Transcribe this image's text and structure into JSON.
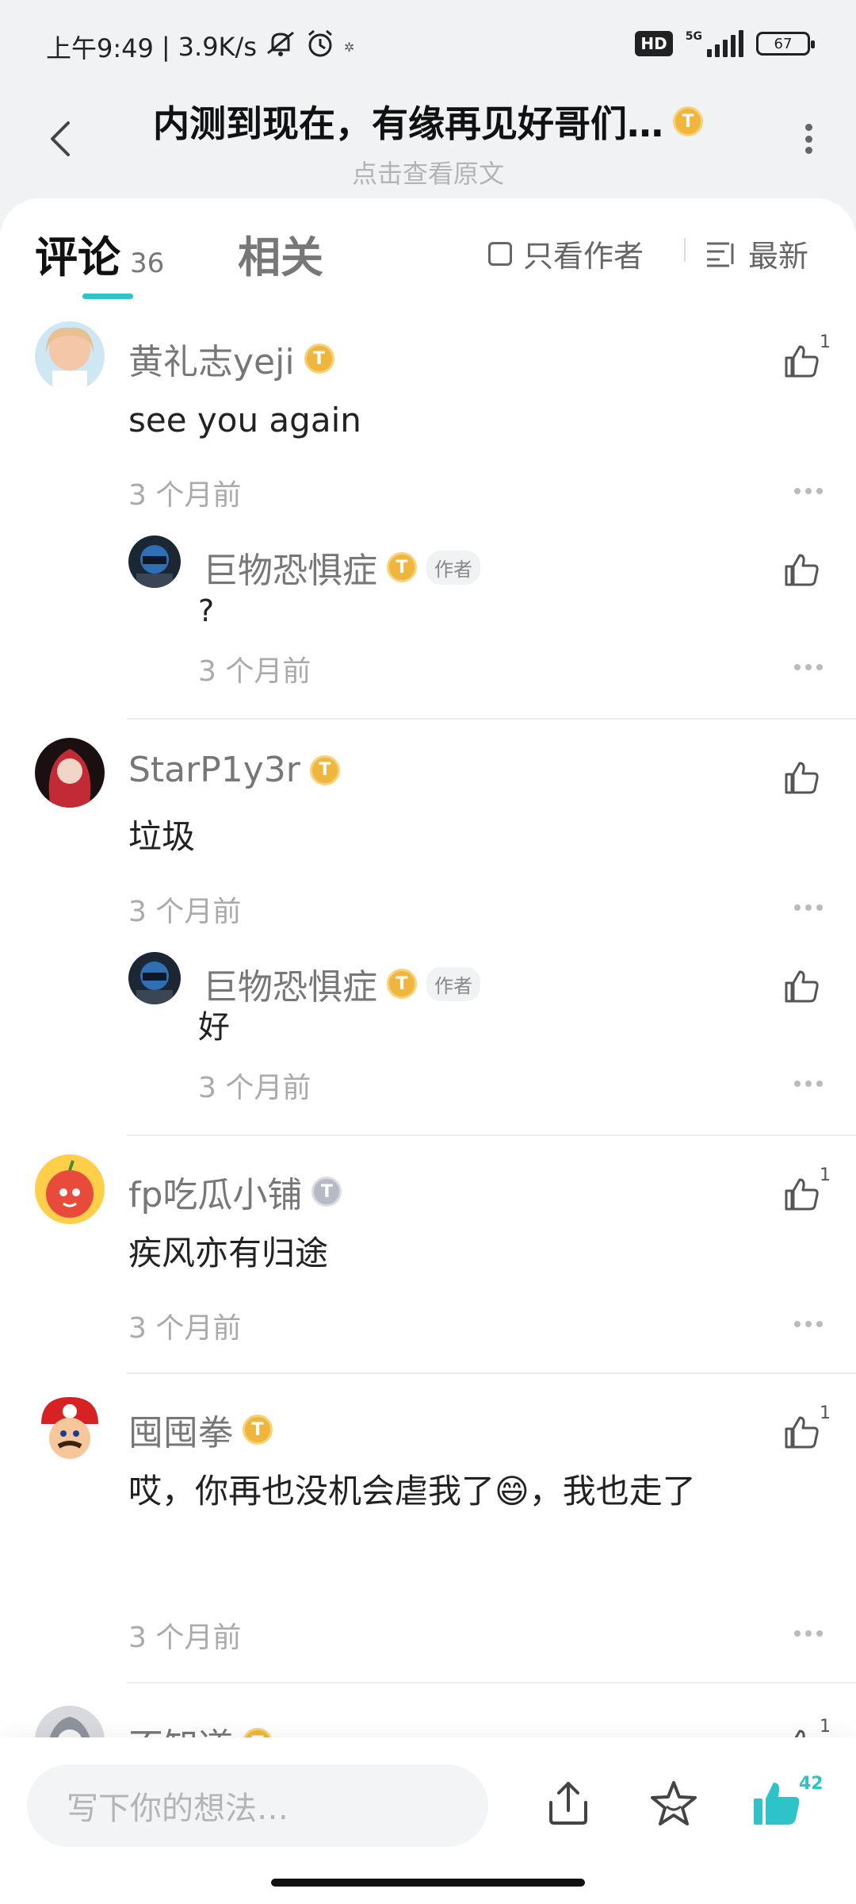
{
  "status_bar": {
    "time": "上午9:49",
    "separator": "|",
    "speed": "3.9K/s",
    "network": "5G",
    "hd": "HD",
    "battery": "67"
  },
  "header": {
    "title": "内测到现在，有缘再见好哥们…",
    "subtitle": "点击查看原文"
  },
  "tabs": {
    "comments_label": "评论",
    "comments_count": "36",
    "related_label": "相关",
    "author_only_label": "只看作者",
    "sort_label": "最新"
  },
  "comments": [
    {
      "user": "黄礼志yeji",
      "badge": "T",
      "text": "see you again",
      "time": "3 个月前",
      "likes": "1",
      "reply": {
        "user": "巨物恐惧症",
        "author_tag": "作者",
        "badge": "T",
        "text": "?",
        "time": "3 个月前"
      }
    },
    {
      "user": "StarP1y3r",
      "badge": "T",
      "text": "垃圾",
      "time": "3 个月前",
      "reply": {
        "user": "巨物恐惧症",
        "author_tag": "作者",
        "badge": "T",
        "text": "好",
        "time": "3 个月前"
      }
    },
    {
      "user": "fp吃瓜小铺",
      "badge": "T",
      "text": "疾风亦有归途",
      "time": "3 个月前",
      "likes": "1"
    },
    {
      "user": "囤囤拳",
      "badge": "T",
      "text": "哎，你再也没机会虐我了😄，我也走了",
      "time": "3 个月前",
      "likes": "1"
    },
    {
      "user": "不知道",
      "badge": "T",
      "likes": "1"
    }
  ],
  "bottom_bar": {
    "input_placeholder": "写下你的想法…",
    "like_total": "42"
  },
  "colors": {
    "accent": "#2ec3c8",
    "badge_gold": "#f0b53c",
    "badge_silver": "#b6bac4",
    "like_active": "#2ec3c8"
  }
}
